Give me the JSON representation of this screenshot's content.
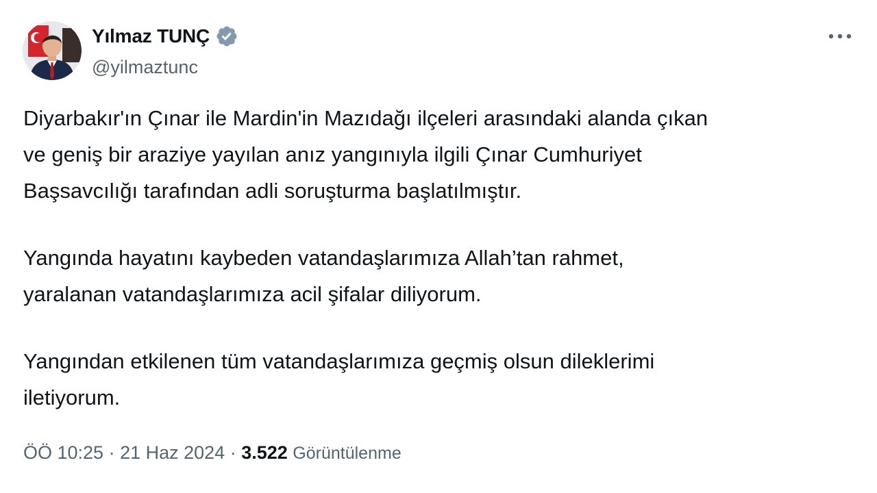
{
  "author": {
    "name": "Yılmaz TUNÇ",
    "handle": "@yilmaztunc",
    "verified_color": "#829aab"
  },
  "tweet": {
    "paragraphs": [
      "Diyarbakır'ın Çınar ile Mardin'in Mazıdağı ilçeleri arasındaki alanda çıkan\nve geniş bir araziye yayılan anız yangınıyla ilgili Çınar Cumhuriyet\nBaşsavcılığı tarafından adli soruşturma başlatılmıştır.",
      "Yangında hayatını kaybeden vatandaşlarımıza Allah’tan rahmet,\nyaralanan vatandaşlarımıza acil şifalar diliyorum.",
      "Yangından etkilenen tüm vatandaşlarımıza geçmiş olsun dileklerimi\niletiyorum."
    ]
  },
  "meta": {
    "time": "ÖÖ 10:25",
    "separator": " · ",
    "date": "21 Haz 2024",
    "views_count": "3.522",
    "views_label": "Görüntülenme"
  },
  "icons": {
    "verified": "verified-badge-icon",
    "more": "more-options-icon"
  },
  "colors": {
    "text_primary": "#0f1419",
    "text_secondary": "#536471",
    "background": "#ffffff"
  }
}
